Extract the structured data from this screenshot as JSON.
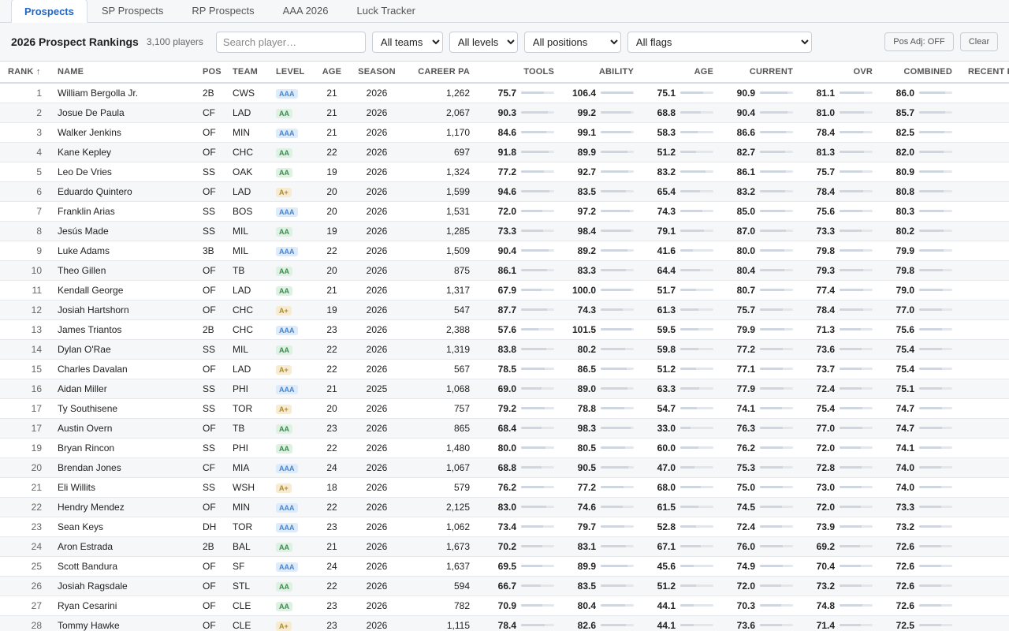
{
  "tabs": [
    {
      "label": "Prospects",
      "active": true
    },
    {
      "label": "SP Prospects",
      "active": false
    },
    {
      "label": "RP Prospects",
      "active": false
    },
    {
      "label": "AAA 2026",
      "active": false
    },
    {
      "label": "Luck Tracker",
      "active": false
    }
  ],
  "toolbar": {
    "title": "2026 Prospect Rankings",
    "count": "3,100 players",
    "search_placeholder": "Search player…",
    "teams": "All teams",
    "levels": "All levels",
    "positions": "All positions",
    "flags": "All flags",
    "pos_adj": "Pos Adj: OFF",
    "clear": "Clear"
  },
  "columns": {
    "rank": "RANK ↑",
    "name": "NAME",
    "pos": "POS",
    "team": "TEAM",
    "level": "LEVEL",
    "age": "AGE",
    "season": "SEASON",
    "career_pa": "CAREER PA",
    "tools": "TOOLS",
    "ability": "ABILITY",
    "age_score": "AGE",
    "current": "CURRENT",
    "ovr": "OVR",
    "combined": "COMBINED",
    "recent": "RECENT F"
  },
  "rows": [
    {
      "rank": "1",
      "name": "William Bergolla Jr.",
      "pos": "2B",
      "team": "CWS",
      "level": "AAA",
      "age": "21",
      "season": "2026",
      "pa": "1,262",
      "tools": "75.7",
      "ability": "106.4",
      "age_score": "75.1",
      "current": "90.9",
      "ovr": "81.1",
      "combined": "86.0"
    },
    {
      "rank": "2",
      "name": "Josue De Paula",
      "pos": "CF",
      "team": "LAD",
      "level": "AA",
      "age": "21",
      "season": "2026",
      "pa": "2,067",
      "tools": "90.3",
      "ability": "99.2",
      "age_score": "68.8",
      "current": "90.4",
      "ovr": "81.0",
      "combined": "85.7"
    },
    {
      "rank": "3",
      "name": "Walker Jenkins",
      "pos": "OF",
      "team": "MIN",
      "level": "AAA",
      "age": "21",
      "season": "2026",
      "pa": "1,170",
      "tools": "84.6",
      "ability": "99.1",
      "age_score": "58.3",
      "current": "86.6",
      "ovr": "78.4",
      "combined": "82.5"
    },
    {
      "rank": "4",
      "name": "Kane Kepley",
      "pos": "OF",
      "team": "CHC",
      "level": "AA",
      "age": "22",
      "season": "2026",
      "pa": "697",
      "tools": "91.8",
      "ability": "89.9",
      "age_score": "51.2",
      "current": "82.7",
      "ovr": "81.3",
      "combined": "82.0"
    },
    {
      "rank": "5",
      "name": "Leo De Vries",
      "pos": "SS",
      "team": "OAK",
      "level": "AA",
      "age": "19",
      "season": "2026",
      "pa": "1,324",
      "tools": "77.2",
      "ability": "92.7",
      "age_score": "83.2",
      "current": "86.1",
      "ovr": "75.7",
      "combined": "80.9"
    },
    {
      "rank": "6",
      "name": "Eduardo Quintero",
      "pos": "OF",
      "team": "LAD",
      "level": "A+",
      "age": "20",
      "season": "2026",
      "pa": "1,599",
      "tools": "94.6",
      "ability": "83.5",
      "age_score": "65.4",
      "current": "83.2",
      "ovr": "78.4",
      "combined": "80.8"
    },
    {
      "rank": "7",
      "name": "Franklin Arias",
      "pos": "SS",
      "team": "BOS",
      "level": "AAA",
      "age": "20",
      "season": "2026",
      "pa": "1,531",
      "tools": "72.0",
      "ability": "97.2",
      "age_score": "74.3",
      "current": "85.0",
      "ovr": "75.6",
      "combined": "80.3"
    },
    {
      "rank": "8",
      "name": "Jesús Made",
      "pos": "SS",
      "team": "MIL",
      "level": "AA",
      "age": "19",
      "season": "2026",
      "pa": "1,285",
      "tools": "73.3",
      "ability": "98.4",
      "age_score": "79.1",
      "current": "87.0",
      "ovr": "73.3",
      "combined": "80.2"
    },
    {
      "rank": "9",
      "name": "Luke Adams",
      "pos": "3B",
      "team": "MIL",
      "level": "AAA",
      "age": "22",
      "season": "2026",
      "pa": "1,509",
      "tools": "90.4",
      "ability": "89.2",
      "age_score": "41.6",
      "current": "80.0",
      "ovr": "79.8",
      "combined": "79.9"
    },
    {
      "rank": "10",
      "name": "Theo Gillen",
      "pos": "OF",
      "team": "TB",
      "level": "AA",
      "age": "20",
      "season": "2026",
      "pa": "875",
      "tools": "86.1",
      "ability": "83.3",
      "age_score": "64.4",
      "current": "80.4",
      "ovr": "79.3",
      "combined": "79.8"
    },
    {
      "rank": "11",
      "name": "Kendall George",
      "pos": "OF",
      "team": "LAD",
      "level": "AA",
      "age": "21",
      "season": "2026",
      "pa": "1,317",
      "tools": "67.9",
      "ability": "100.0",
      "age_score": "51.7",
      "current": "80.7",
      "ovr": "77.4",
      "combined": "79.0"
    },
    {
      "rank": "12",
      "name": "Josiah Hartshorn",
      "pos": "OF",
      "team": "CHC",
      "level": "A+",
      "age": "19",
      "season": "2026",
      "pa": "547",
      "tools": "87.7",
      "ability": "74.3",
      "age_score": "61.3",
      "current": "75.7",
      "ovr": "78.4",
      "combined": "77.0"
    },
    {
      "rank": "13",
      "name": "James Triantos",
      "pos": "2B",
      "team": "CHC",
      "level": "AAA",
      "age": "23",
      "season": "2026",
      "pa": "2,388",
      "tools": "57.6",
      "ability": "101.5",
      "age_score": "59.5",
      "current": "79.9",
      "ovr": "71.3",
      "combined": "75.6"
    },
    {
      "rank": "14",
      "name": "Dylan O'Rae",
      "pos": "SS",
      "team": "MIL",
      "level": "AA",
      "age": "22",
      "season": "2026",
      "pa": "1,319",
      "tools": "83.8",
      "ability": "80.2",
      "age_score": "59.8",
      "current": "77.2",
      "ovr": "73.6",
      "combined": "75.4"
    },
    {
      "rank": "15",
      "name": "Charles Davalan",
      "pos": "OF",
      "team": "LAD",
      "level": "A+",
      "age": "22",
      "season": "2026",
      "pa": "567",
      "tools": "78.5",
      "ability": "86.5",
      "age_score": "51.2",
      "current": "77.1",
      "ovr": "73.7",
      "combined": "75.4"
    },
    {
      "rank": "16",
      "name": "Aidan Miller",
      "pos": "SS",
      "team": "PHI",
      "level": "AAA",
      "age": "21",
      "season": "2025",
      "pa": "1,068",
      "tools": "69.0",
      "ability": "89.0",
      "age_score": "63.3",
      "current": "77.9",
      "ovr": "72.4",
      "combined": "75.1"
    },
    {
      "rank": "17",
      "name": "Ty Southisene",
      "pos": "SS",
      "team": "TOR",
      "level": "A+",
      "age": "20",
      "season": "2026",
      "pa": "757",
      "tools": "79.2",
      "ability": "78.8",
      "age_score": "54.7",
      "current": "74.1",
      "ovr": "75.4",
      "combined": "74.7"
    },
    {
      "rank": "17",
      "name": "Austin Overn",
      "pos": "OF",
      "team": "TB",
      "level": "AA",
      "age": "23",
      "season": "2026",
      "pa": "865",
      "tools": "68.4",
      "ability": "98.3",
      "age_score": "33.0",
      "current": "76.3",
      "ovr": "77.0",
      "combined": "74.7"
    },
    {
      "rank": "19",
      "name": "Bryan Rincon",
      "pos": "SS",
      "team": "PHI",
      "level": "AA",
      "age": "22",
      "season": "2026",
      "pa": "1,480",
      "tools": "80.0",
      "ability": "80.5",
      "age_score": "60.0",
      "current": "76.2",
      "ovr": "72.0",
      "combined": "74.1"
    },
    {
      "rank": "20",
      "name": "Brendan Jones",
      "pos": "CF",
      "team": "MIA",
      "level": "AAA",
      "age": "24",
      "season": "2026",
      "pa": "1,067",
      "tools": "68.8",
      "ability": "90.5",
      "age_score": "47.0",
      "current": "75.3",
      "ovr": "72.8",
      "combined": "74.0"
    },
    {
      "rank": "21",
      "name": "Eli Willits",
      "pos": "SS",
      "team": "WSH",
      "level": "A+",
      "age": "18",
      "season": "2026",
      "pa": "579",
      "tools": "76.2",
      "ability": "77.2",
      "age_score": "68.0",
      "current": "75.0",
      "ovr": "73.0",
      "combined": "74.0"
    },
    {
      "rank": "22",
      "name": "Hendry Mendez",
      "pos": "OF",
      "team": "MIN",
      "level": "AAA",
      "age": "22",
      "season": "2026",
      "pa": "2,125",
      "tools": "83.0",
      "ability": "74.6",
      "age_score": "61.5",
      "current": "74.5",
      "ovr": "72.0",
      "combined": "73.3"
    },
    {
      "rank": "23",
      "name": "Sean Keys",
      "pos": "DH",
      "team": "TOR",
      "level": "AAA",
      "age": "23",
      "season": "2026",
      "pa": "1,062",
      "tools": "73.4",
      "ability": "79.7",
      "age_score": "52.8",
      "current": "72.4",
      "ovr": "73.9",
      "combined": "73.2"
    },
    {
      "rank": "24",
      "name": "Aron Estrada",
      "pos": "2B",
      "team": "BAL",
      "level": "AA",
      "age": "21",
      "season": "2026",
      "pa": "1,673",
      "tools": "70.2",
      "ability": "83.1",
      "age_score": "67.1",
      "current": "76.0",
      "ovr": "69.2",
      "combined": "72.6"
    },
    {
      "rank": "25",
      "name": "Scott Bandura",
      "pos": "OF",
      "team": "SF",
      "level": "AAA",
      "age": "24",
      "season": "2026",
      "pa": "1,637",
      "tools": "69.5",
      "ability": "89.9",
      "age_score": "45.6",
      "current": "74.9",
      "ovr": "70.4",
      "combined": "72.6"
    },
    {
      "rank": "26",
      "name": "Josiah Ragsdale",
      "pos": "OF",
      "team": "STL",
      "level": "AA",
      "age": "22",
      "season": "2026",
      "pa": "594",
      "tools": "66.7",
      "ability": "83.5",
      "age_score": "51.2",
      "current": "72.0",
      "ovr": "73.2",
      "combined": "72.6"
    },
    {
      "rank": "27",
      "name": "Ryan Cesarini",
      "pos": "OF",
      "team": "CLE",
      "level": "AA",
      "age": "23",
      "season": "2026",
      "pa": "782",
      "tools": "70.9",
      "ability": "80.4",
      "age_score": "44.1",
      "current": "70.3",
      "ovr": "74.8",
      "combined": "72.6"
    },
    {
      "rank": "28",
      "name": "Tommy Hawke",
      "pos": "OF",
      "team": "CLE",
      "level": "A+",
      "age": "23",
      "season": "2026",
      "pa": "1,115",
      "tools": "78.4",
      "ability": "82.6",
      "age_score": "44.1",
      "current": "73.6",
      "ovr": "71.4",
      "combined": "72.5"
    }
  ]
}
